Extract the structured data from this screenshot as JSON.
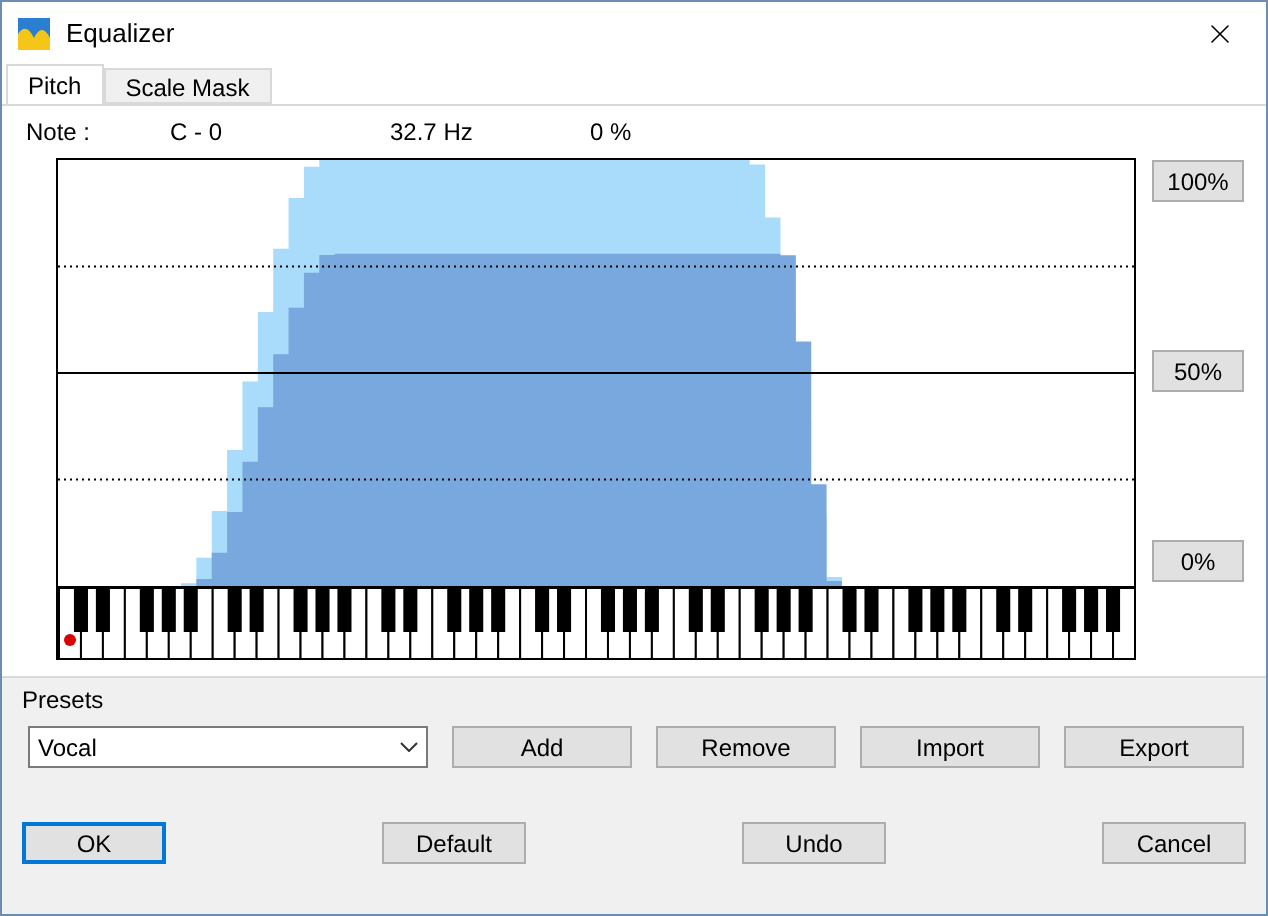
{
  "window": {
    "title": "Equalizer"
  },
  "tabs": [
    {
      "label": "Pitch",
      "selected": true
    },
    {
      "label": "Scale Mask",
      "selected": false
    }
  ],
  "note": {
    "label": "Note :",
    "name": "C - 0",
    "frequency": "32.7 Hz",
    "percent": "0 %"
  },
  "level_buttons": [
    "100%",
    "50%",
    "0%"
  ],
  "presets": {
    "label": "Presets",
    "value": "Vocal",
    "buttons": [
      "Add",
      "Remove",
      "Import",
      "Export"
    ]
  },
  "footer_buttons": [
    {
      "label": "OK",
      "focused": true
    },
    {
      "label": "Default",
      "focused": false
    },
    {
      "label": "Undo",
      "focused": false
    },
    {
      "label": "Cancel",
      "focused": false
    }
  ]
}
